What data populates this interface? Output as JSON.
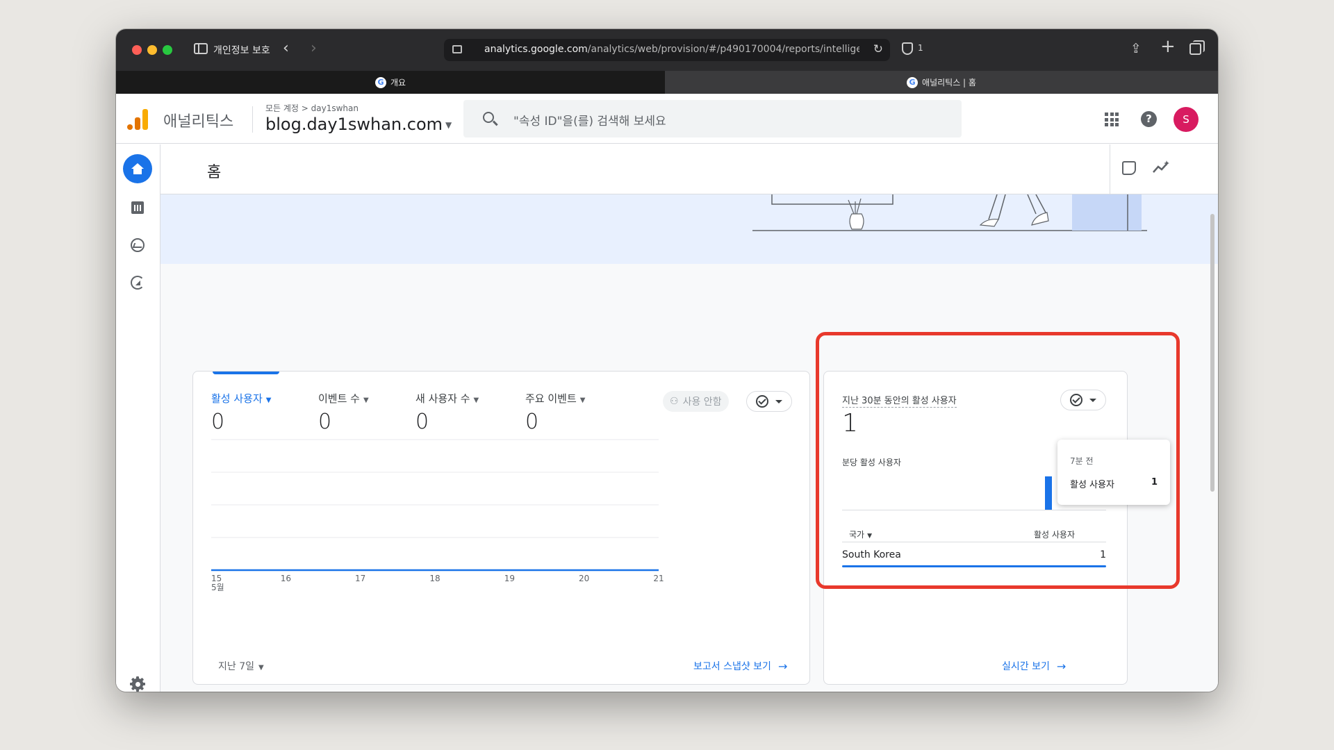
{
  "browser": {
    "privacy_label": "개인정보 보호",
    "url_host": "analytics.google.com",
    "url_path": "/analytics/web/provision/#/p490170004/reports/intelligent",
    "shield_count": "1",
    "tabs": [
      {
        "label": "개요",
        "active": false
      },
      {
        "label": "애널리틱스 | 홈",
        "active": true
      }
    ]
  },
  "header": {
    "product_name": "애널리틱스",
    "breadcrumb": "모든 계정 > day1swhan",
    "property_name": "blog.day1swhan.com",
    "search_placeholder": "\"속성 ID\"을(를) 검색해 보세요",
    "avatar_letter": "S"
  },
  "page": {
    "title": "홈"
  },
  "overview_card": {
    "metrics": [
      {
        "label": "활성 사용자",
        "value": "0",
        "active": true
      },
      {
        "label": "이벤트 수",
        "value": "0",
        "active": false
      },
      {
        "label": "새 사용자 수",
        "value": "0",
        "active": false
      },
      {
        "label": "주요 이벤트",
        "value": "0",
        "active": false
      }
    ],
    "unused_chip": "사용 안함",
    "date_range": "지난 7일",
    "snapshot_link": "보고서 스냅샷 보기"
  },
  "chart_data": {
    "type": "line",
    "categories": [
      "15",
      "16",
      "17",
      "18",
      "19",
      "20",
      "21"
    ],
    "x_sublabel": "5월",
    "series": [
      {
        "values": [
          0,
          0,
          0,
          0,
          0,
          0,
          0
        ]
      }
    ],
    "title": "",
    "xlabel": "",
    "ylabel": "",
    "grid": true,
    "color": "#1a73e8"
  },
  "realtime_card": {
    "title": "지난 30분 동안의 활성 사용자",
    "value": "1",
    "subtitle": "분당 활성 사용자",
    "col_country": "국가",
    "col_active": "활성 사용자",
    "rows": [
      {
        "country": "South Korea",
        "count": "1"
      }
    ],
    "realtime_link": "실시간 보기",
    "tooltip": {
      "time": "7분 전",
      "label": "활성 사용자",
      "value": "1"
    }
  },
  "colors": {
    "accent": "#1a73e8",
    "highlight": "#e8392c",
    "avatar": "#d81b60"
  }
}
